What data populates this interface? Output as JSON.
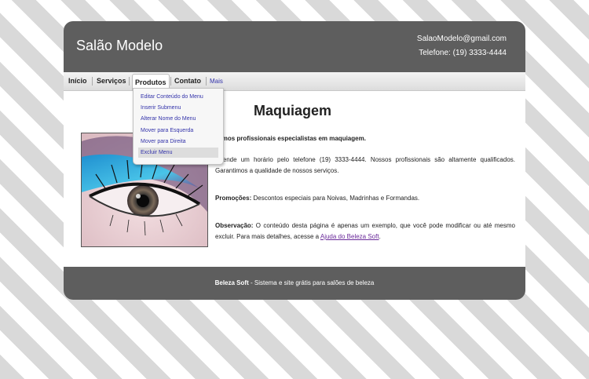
{
  "site": {
    "title": "Salão Modelo",
    "email": "SalaoModelo@gmail.com",
    "phone": "Telefone: (19) 3333-4444"
  },
  "nav": {
    "items": [
      "Início",
      "Serviços",
      "Produtos",
      "Contato"
    ],
    "active": "Produtos",
    "more": "Mais"
  },
  "dropdown": {
    "items": [
      "Editar Conteúdo do Menu",
      "Inserir Submenu",
      "Alterar Nome do Menu",
      "Mover para Esquerda",
      "Mover para Direita",
      "Excluir Menu"
    ],
    "highlighted": "Excluir Menu"
  },
  "page": {
    "heading": "Maquiagem",
    "intro": "Temos profissionais especialistas em maquiagem.",
    "schedule": "Agende um horário pelo telefone (19) 3333-4444. Nossos profissionais são altamente qualificados. Garantimos a qualidade de nossos serviços.",
    "promo_label": "Promoções:",
    "promo_text": "Descontos especiais para Noivas, Madrinhas e Formandas.",
    "note_label": "Observação:",
    "note_text": "O conteúdo desta página é apenas um exemplo, que você pode modificar ou até mesmo excluir. Para mais detalhes, acesse a",
    "help_link": "Ajuda do Beleza Soft",
    "note_end": "."
  },
  "footer": {
    "brand": "Beleza Soft",
    "tagline": "- Sistema e site grátis para salões de beleza"
  },
  "colors": {
    "header_bg": "#5e5e5e",
    "link": "#3333aa"
  }
}
